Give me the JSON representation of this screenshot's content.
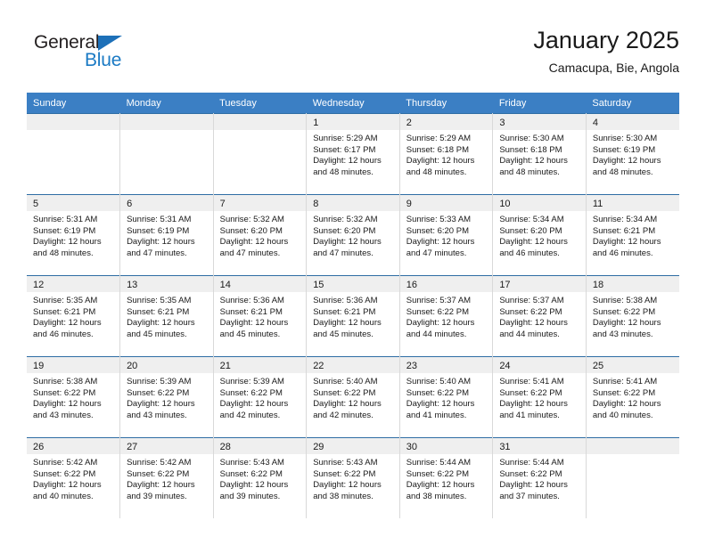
{
  "brand": {
    "name_top": "General",
    "name_bottom": "Blue",
    "accent_color": "#1b7ac4",
    "triangle_color": "#1d70b8"
  },
  "header": {
    "title": "January 2025",
    "subtitle": "Camacupa, Bie, Angola"
  },
  "calendar": {
    "header_bg": "#3b7fc4",
    "daynum_bg": "#efefef",
    "row_border_color": "#2e6da4",
    "weekday_headers": [
      "Sunday",
      "Monday",
      "Tuesday",
      "Wednesday",
      "Thursday",
      "Friday",
      "Saturday"
    ],
    "weeks": [
      [
        {
          "day": "",
          "sunrise": "",
          "sunset": "",
          "daylight_line1": "",
          "daylight_line2": ""
        },
        {
          "day": "",
          "sunrise": "",
          "sunset": "",
          "daylight_line1": "",
          "daylight_line2": ""
        },
        {
          "day": "",
          "sunrise": "",
          "sunset": "",
          "daylight_line1": "",
          "daylight_line2": ""
        },
        {
          "day": "1",
          "sunrise": "Sunrise: 5:29 AM",
          "sunset": "Sunset: 6:17 PM",
          "daylight_line1": "Daylight: 12 hours",
          "daylight_line2": "and 48 minutes."
        },
        {
          "day": "2",
          "sunrise": "Sunrise: 5:29 AM",
          "sunset": "Sunset: 6:18 PM",
          "daylight_line1": "Daylight: 12 hours",
          "daylight_line2": "and 48 minutes."
        },
        {
          "day": "3",
          "sunrise": "Sunrise: 5:30 AM",
          "sunset": "Sunset: 6:18 PM",
          "daylight_line1": "Daylight: 12 hours",
          "daylight_line2": "and 48 minutes."
        },
        {
          "day": "4",
          "sunrise": "Sunrise: 5:30 AM",
          "sunset": "Sunset: 6:19 PM",
          "daylight_line1": "Daylight: 12 hours",
          "daylight_line2": "and 48 minutes."
        }
      ],
      [
        {
          "day": "5",
          "sunrise": "Sunrise: 5:31 AM",
          "sunset": "Sunset: 6:19 PM",
          "daylight_line1": "Daylight: 12 hours",
          "daylight_line2": "and 48 minutes."
        },
        {
          "day": "6",
          "sunrise": "Sunrise: 5:31 AM",
          "sunset": "Sunset: 6:19 PM",
          "daylight_line1": "Daylight: 12 hours",
          "daylight_line2": "and 47 minutes."
        },
        {
          "day": "7",
          "sunrise": "Sunrise: 5:32 AM",
          "sunset": "Sunset: 6:20 PM",
          "daylight_line1": "Daylight: 12 hours",
          "daylight_line2": "and 47 minutes."
        },
        {
          "day": "8",
          "sunrise": "Sunrise: 5:32 AM",
          "sunset": "Sunset: 6:20 PM",
          "daylight_line1": "Daylight: 12 hours",
          "daylight_line2": "and 47 minutes."
        },
        {
          "day": "9",
          "sunrise": "Sunrise: 5:33 AM",
          "sunset": "Sunset: 6:20 PM",
          "daylight_line1": "Daylight: 12 hours",
          "daylight_line2": "and 47 minutes."
        },
        {
          "day": "10",
          "sunrise": "Sunrise: 5:34 AM",
          "sunset": "Sunset: 6:20 PM",
          "daylight_line1": "Daylight: 12 hours",
          "daylight_line2": "and 46 minutes."
        },
        {
          "day": "11",
          "sunrise": "Sunrise: 5:34 AM",
          "sunset": "Sunset: 6:21 PM",
          "daylight_line1": "Daylight: 12 hours",
          "daylight_line2": "and 46 minutes."
        }
      ],
      [
        {
          "day": "12",
          "sunrise": "Sunrise: 5:35 AM",
          "sunset": "Sunset: 6:21 PM",
          "daylight_line1": "Daylight: 12 hours",
          "daylight_line2": "and 46 minutes."
        },
        {
          "day": "13",
          "sunrise": "Sunrise: 5:35 AM",
          "sunset": "Sunset: 6:21 PM",
          "daylight_line1": "Daylight: 12 hours",
          "daylight_line2": "and 45 minutes."
        },
        {
          "day": "14",
          "sunrise": "Sunrise: 5:36 AM",
          "sunset": "Sunset: 6:21 PM",
          "daylight_line1": "Daylight: 12 hours",
          "daylight_line2": "and 45 minutes."
        },
        {
          "day": "15",
          "sunrise": "Sunrise: 5:36 AM",
          "sunset": "Sunset: 6:21 PM",
          "daylight_line1": "Daylight: 12 hours",
          "daylight_line2": "and 45 minutes."
        },
        {
          "day": "16",
          "sunrise": "Sunrise: 5:37 AM",
          "sunset": "Sunset: 6:22 PM",
          "daylight_line1": "Daylight: 12 hours",
          "daylight_line2": "and 44 minutes."
        },
        {
          "day": "17",
          "sunrise": "Sunrise: 5:37 AM",
          "sunset": "Sunset: 6:22 PM",
          "daylight_line1": "Daylight: 12 hours",
          "daylight_line2": "and 44 minutes."
        },
        {
          "day": "18",
          "sunrise": "Sunrise: 5:38 AM",
          "sunset": "Sunset: 6:22 PM",
          "daylight_line1": "Daylight: 12 hours",
          "daylight_line2": "and 43 minutes."
        }
      ],
      [
        {
          "day": "19",
          "sunrise": "Sunrise: 5:38 AM",
          "sunset": "Sunset: 6:22 PM",
          "daylight_line1": "Daylight: 12 hours",
          "daylight_line2": "and 43 minutes."
        },
        {
          "day": "20",
          "sunrise": "Sunrise: 5:39 AM",
          "sunset": "Sunset: 6:22 PM",
          "daylight_line1": "Daylight: 12 hours",
          "daylight_line2": "and 43 minutes."
        },
        {
          "day": "21",
          "sunrise": "Sunrise: 5:39 AM",
          "sunset": "Sunset: 6:22 PM",
          "daylight_line1": "Daylight: 12 hours",
          "daylight_line2": "and 42 minutes."
        },
        {
          "day": "22",
          "sunrise": "Sunrise: 5:40 AM",
          "sunset": "Sunset: 6:22 PM",
          "daylight_line1": "Daylight: 12 hours",
          "daylight_line2": "and 42 minutes."
        },
        {
          "day": "23",
          "sunrise": "Sunrise: 5:40 AM",
          "sunset": "Sunset: 6:22 PM",
          "daylight_line1": "Daylight: 12 hours",
          "daylight_line2": "and 41 minutes."
        },
        {
          "day": "24",
          "sunrise": "Sunrise: 5:41 AM",
          "sunset": "Sunset: 6:22 PM",
          "daylight_line1": "Daylight: 12 hours",
          "daylight_line2": "and 41 minutes."
        },
        {
          "day": "25",
          "sunrise": "Sunrise: 5:41 AM",
          "sunset": "Sunset: 6:22 PM",
          "daylight_line1": "Daylight: 12 hours",
          "daylight_line2": "and 40 minutes."
        }
      ],
      [
        {
          "day": "26",
          "sunrise": "Sunrise: 5:42 AM",
          "sunset": "Sunset: 6:22 PM",
          "daylight_line1": "Daylight: 12 hours",
          "daylight_line2": "and 40 minutes."
        },
        {
          "day": "27",
          "sunrise": "Sunrise: 5:42 AM",
          "sunset": "Sunset: 6:22 PM",
          "daylight_line1": "Daylight: 12 hours",
          "daylight_line2": "and 39 minutes."
        },
        {
          "day": "28",
          "sunrise": "Sunrise: 5:43 AM",
          "sunset": "Sunset: 6:22 PM",
          "daylight_line1": "Daylight: 12 hours",
          "daylight_line2": "and 39 minutes."
        },
        {
          "day": "29",
          "sunrise": "Sunrise: 5:43 AM",
          "sunset": "Sunset: 6:22 PM",
          "daylight_line1": "Daylight: 12 hours",
          "daylight_line2": "and 38 minutes."
        },
        {
          "day": "30",
          "sunrise": "Sunrise: 5:44 AM",
          "sunset": "Sunset: 6:22 PM",
          "daylight_line1": "Daylight: 12 hours",
          "daylight_line2": "and 38 minutes."
        },
        {
          "day": "31",
          "sunrise": "Sunrise: 5:44 AM",
          "sunset": "Sunset: 6:22 PM",
          "daylight_line1": "Daylight: 12 hours",
          "daylight_line2": "and 37 minutes."
        },
        {
          "day": "",
          "sunrise": "",
          "sunset": "",
          "daylight_line1": "",
          "daylight_line2": ""
        }
      ]
    ]
  }
}
